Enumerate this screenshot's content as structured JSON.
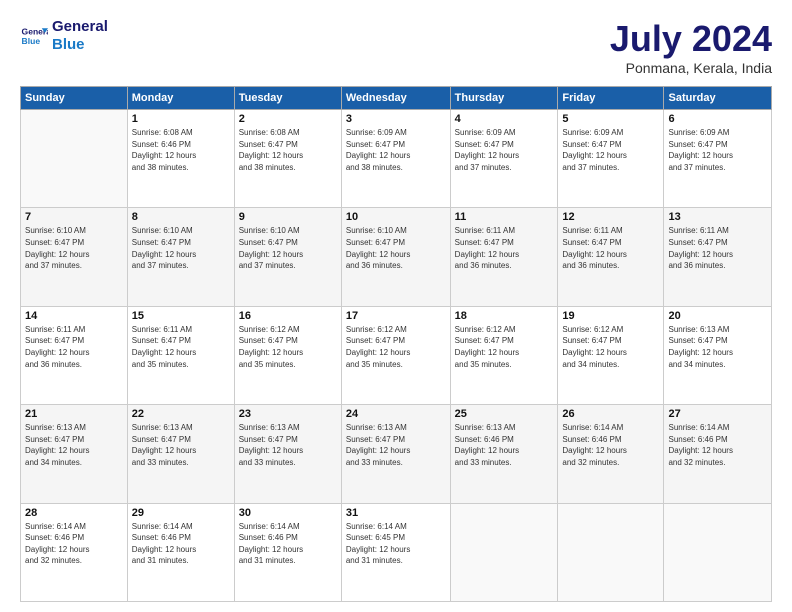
{
  "header": {
    "logo_line1": "General",
    "logo_line2": "Blue",
    "month": "July 2024",
    "location": "Ponmana, Kerala, India"
  },
  "days_of_week": [
    "Sunday",
    "Monday",
    "Tuesday",
    "Wednesday",
    "Thursday",
    "Friday",
    "Saturday"
  ],
  "weeks": [
    [
      {
        "num": "",
        "detail": ""
      },
      {
        "num": "1",
        "detail": "Sunrise: 6:08 AM\nSunset: 6:46 PM\nDaylight: 12 hours\nand 38 minutes."
      },
      {
        "num": "2",
        "detail": "Sunrise: 6:08 AM\nSunset: 6:47 PM\nDaylight: 12 hours\nand 38 minutes."
      },
      {
        "num": "3",
        "detail": "Sunrise: 6:09 AM\nSunset: 6:47 PM\nDaylight: 12 hours\nand 38 minutes."
      },
      {
        "num": "4",
        "detail": "Sunrise: 6:09 AM\nSunset: 6:47 PM\nDaylight: 12 hours\nand 37 minutes."
      },
      {
        "num": "5",
        "detail": "Sunrise: 6:09 AM\nSunset: 6:47 PM\nDaylight: 12 hours\nand 37 minutes."
      },
      {
        "num": "6",
        "detail": "Sunrise: 6:09 AM\nSunset: 6:47 PM\nDaylight: 12 hours\nand 37 minutes."
      }
    ],
    [
      {
        "num": "7",
        "detail": "Sunrise: 6:10 AM\nSunset: 6:47 PM\nDaylight: 12 hours\nand 37 minutes."
      },
      {
        "num": "8",
        "detail": "Sunrise: 6:10 AM\nSunset: 6:47 PM\nDaylight: 12 hours\nand 37 minutes."
      },
      {
        "num": "9",
        "detail": "Sunrise: 6:10 AM\nSunset: 6:47 PM\nDaylight: 12 hours\nand 37 minutes."
      },
      {
        "num": "10",
        "detail": "Sunrise: 6:10 AM\nSunset: 6:47 PM\nDaylight: 12 hours\nand 36 minutes."
      },
      {
        "num": "11",
        "detail": "Sunrise: 6:11 AM\nSunset: 6:47 PM\nDaylight: 12 hours\nand 36 minutes."
      },
      {
        "num": "12",
        "detail": "Sunrise: 6:11 AM\nSunset: 6:47 PM\nDaylight: 12 hours\nand 36 minutes."
      },
      {
        "num": "13",
        "detail": "Sunrise: 6:11 AM\nSunset: 6:47 PM\nDaylight: 12 hours\nand 36 minutes."
      }
    ],
    [
      {
        "num": "14",
        "detail": "Sunrise: 6:11 AM\nSunset: 6:47 PM\nDaylight: 12 hours\nand 36 minutes."
      },
      {
        "num": "15",
        "detail": "Sunrise: 6:11 AM\nSunset: 6:47 PM\nDaylight: 12 hours\nand 35 minutes."
      },
      {
        "num": "16",
        "detail": "Sunrise: 6:12 AM\nSunset: 6:47 PM\nDaylight: 12 hours\nand 35 minutes."
      },
      {
        "num": "17",
        "detail": "Sunrise: 6:12 AM\nSunset: 6:47 PM\nDaylight: 12 hours\nand 35 minutes."
      },
      {
        "num": "18",
        "detail": "Sunrise: 6:12 AM\nSunset: 6:47 PM\nDaylight: 12 hours\nand 35 minutes."
      },
      {
        "num": "19",
        "detail": "Sunrise: 6:12 AM\nSunset: 6:47 PM\nDaylight: 12 hours\nand 34 minutes."
      },
      {
        "num": "20",
        "detail": "Sunrise: 6:13 AM\nSunset: 6:47 PM\nDaylight: 12 hours\nand 34 minutes."
      }
    ],
    [
      {
        "num": "21",
        "detail": "Sunrise: 6:13 AM\nSunset: 6:47 PM\nDaylight: 12 hours\nand 34 minutes."
      },
      {
        "num": "22",
        "detail": "Sunrise: 6:13 AM\nSunset: 6:47 PM\nDaylight: 12 hours\nand 33 minutes."
      },
      {
        "num": "23",
        "detail": "Sunrise: 6:13 AM\nSunset: 6:47 PM\nDaylight: 12 hours\nand 33 minutes."
      },
      {
        "num": "24",
        "detail": "Sunrise: 6:13 AM\nSunset: 6:47 PM\nDaylight: 12 hours\nand 33 minutes."
      },
      {
        "num": "25",
        "detail": "Sunrise: 6:13 AM\nSunset: 6:46 PM\nDaylight: 12 hours\nand 33 minutes."
      },
      {
        "num": "26",
        "detail": "Sunrise: 6:14 AM\nSunset: 6:46 PM\nDaylight: 12 hours\nand 32 minutes."
      },
      {
        "num": "27",
        "detail": "Sunrise: 6:14 AM\nSunset: 6:46 PM\nDaylight: 12 hours\nand 32 minutes."
      }
    ],
    [
      {
        "num": "28",
        "detail": "Sunrise: 6:14 AM\nSunset: 6:46 PM\nDaylight: 12 hours\nand 32 minutes."
      },
      {
        "num": "29",
        "detail": "Sunrise: 6:14 AM\nSunset: 6:46 PM\nDaylight: 12 hours\nand 31 minutes."
      },
      {
        "num": "30",
        "detail": "Sunrise: 6:14 AM\nSunset: 6:46 PM\nDaylight: 12 hours\nand 31 minutes."
      },
      {
        "num": "31",
        "detail": "Sunrise: 6:14 AM\nSunset: 6:45 PM\nDaylight: 12 hours\nand 31 minutes."
      },
      {
        "num": "",
        "detail": ""
      },
      {
        "num": "",
        "detail": ""
      },
      {
        "num": "",
        "detail": ""
      }
    ]
  ]
}
